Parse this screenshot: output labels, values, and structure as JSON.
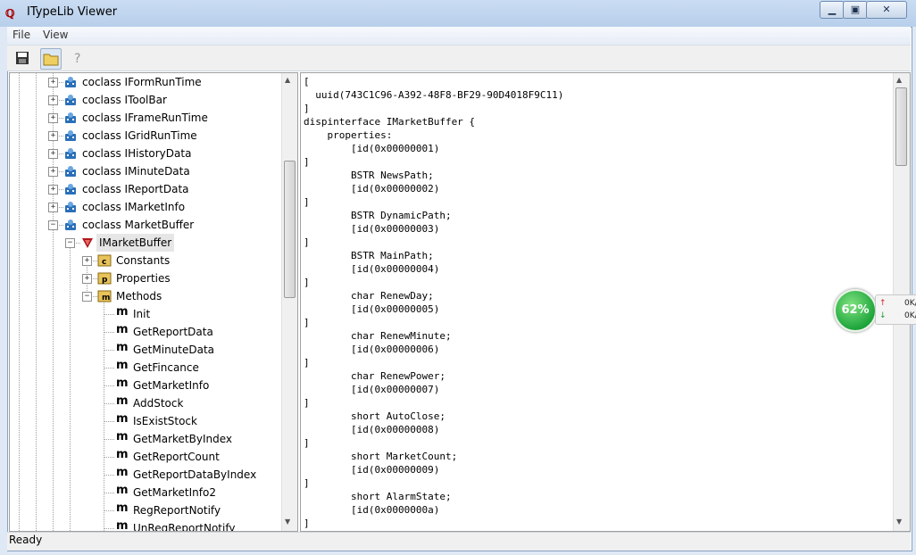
{
  "window": {
    "title": "ITypeLib Viewer",
    "icon": "typelib-app-icon"
  },
  "menu": [
    "File",
    "View"
  ],
  "toolbar": [
    {
      "name": "save-icon",
      "active": false
    },
    {
      "name": "open-folder-icon",
      "active": true
    },
    {
      "name": "help-icon",
      "active": false
    }
  ],
  "tree": {
    "items": [
      {
        "label": "coclass IFormRunTime",
        "kind": "coclass",
        "level": 0,
        "expander": "+"
      },
      {
        "label": "coclass IToolBar",
        "kind": "coclass",
        "level": 0,
        "expander": "+"
      },
      {
        "label": "coclass IFrameRunTime",
        "kind": "coclass",
        "level": 0,
        "expander": "+"
      },
      {
        "label": "coclass IGridRunTime",
        "kind": "coclass",
        "level": 0,
        "expander": "+"
      },
      {
        "label": "coclass IHistoryData",
        "kind": "coclass",
        "level": 0,
        "expander": "+"
      },
      {
        "label": "coclass IMinuteData",
        "kind": "coclass",
        "level": 0,
        "expander": "+"
      },
      {
        "label": "coclass IReportData",
        "kind": "coclass",
        "level": 0,
        "expander": "+"
      },
      {
        "label": "coclass IMarketInfo",
        "kind": "coclass",
        "level": 0,
        "expander": "+"
      },
      {
        "label": "coclass MarketBuffer",
        "kind": "coclass",
        "level": 0,
        "expander": "-"
      },
      {
        "label": "IMarketBuffer",
        "kind": "interface",
        "level": 1,
        "expander": "-",
        "selected": true
      },
      {
        "label": "Constants",
        "kind": "folder-c",
        "level": 2,
        "expander": "+"
      },
      {
        "label": "Properties",
        "kind": "folder-p",
        "level": 2,
        "expander": "+"
      },
      {
        "label": "Methods",
        "kind": "folder-m",
        "level": 2,
        "expander": "-"
      },
      {
        "label": "Init",
        "kind": "method",
        "level": 3
      },
      {
        "label": "GetReportData",
        "kind": "method",
        "level": 3
      },
      {
        "label": "GetMinuteData",
        "kind": "method",
        "level": 3
      },
      {
        "label": "GetFincance",
        "kind": "method",
        "level": 3
      },
      {
        "label": "GetMarketInfo",
        "kind": "method",
        "level": 3
      },
      {
        "label": "AddStock",
        "kind": "method",
        "level": 3
      },
      {
        "label": "IsExistStock",
        "kind": "method",
        "level": 3
      },
      {
        "label": "GetMarketByIndex",
        "kind": "method",
        "level": 3
      },
      {
        "label": "GetReportCount",
        "kind": "method",
        "level": 3
      },
      {
        "label": "GetReportDataByIndex",
        "kind": "method",
        "level": 3
      },
      {
        "label": "GetMarketInfo2",
        "kind": "method",
        "level": 3
      },
      {
        "label": "RegReportNotify",
        "kind": "method",
        "level": 3
      },
      {
        "label": "UnRegReportNotify",
        "kind": "method",
        "level": 3
      }
    ],
    "method_glyph": "m",
    "scroll_fraction": 0.25
  },
  "code": {
    "lines": [
      "[",
      "  uuid(743C1C96-A392-48F8-BF29-90D4018F9C11)",
      "]",
      "dispinterface IMarketBuffer {",
      "    properties:",
      "        [id(0x00000001)",
      "]",
      "        BSTR NewsPath;",
      "        [id(0x00000002)",
      "]",
      "        BSTR DynamicPath;",
      "        [id(0x00000003)",
      "]",
      "        BSTR MainPath;",
      "        [id(0x00000004)",
      "]",
      "        char RenewDay;",
      "        [id(0x00000005)",
      "]",
      "        char RenewMinute;",
      "        [id(0x00000006)",
      "]",
      "        char RenewPower;",
      "        [id(0x00000007)",
      "]",
      "        short AutoClose;",
      "        [id(0x00000008)",
      "]",
      "        short MarketCount;",
      "        [id(0x00000009)",
      "]",
      "        short AlarmState;",
      "        [id(0x0000000a)",
      "]"
    ],
    "scroll_fraction": 0.0
  },
  "status": {
    "text": "Ready"
  },
  "net_widget": {
    "percent": "62%",
    "upload": "0K/",
    "download": "0K/",
    "up_color": "#d32020",
    "down_color": "#1a9a2a"
  },
  "colors": {
    "selection": "#e6e6e6",
    "interface_icon": "#b01818",
    "coclass_icon": "#2a6fb8",
    "folder_icon": "#e8c35a"
  }
}
